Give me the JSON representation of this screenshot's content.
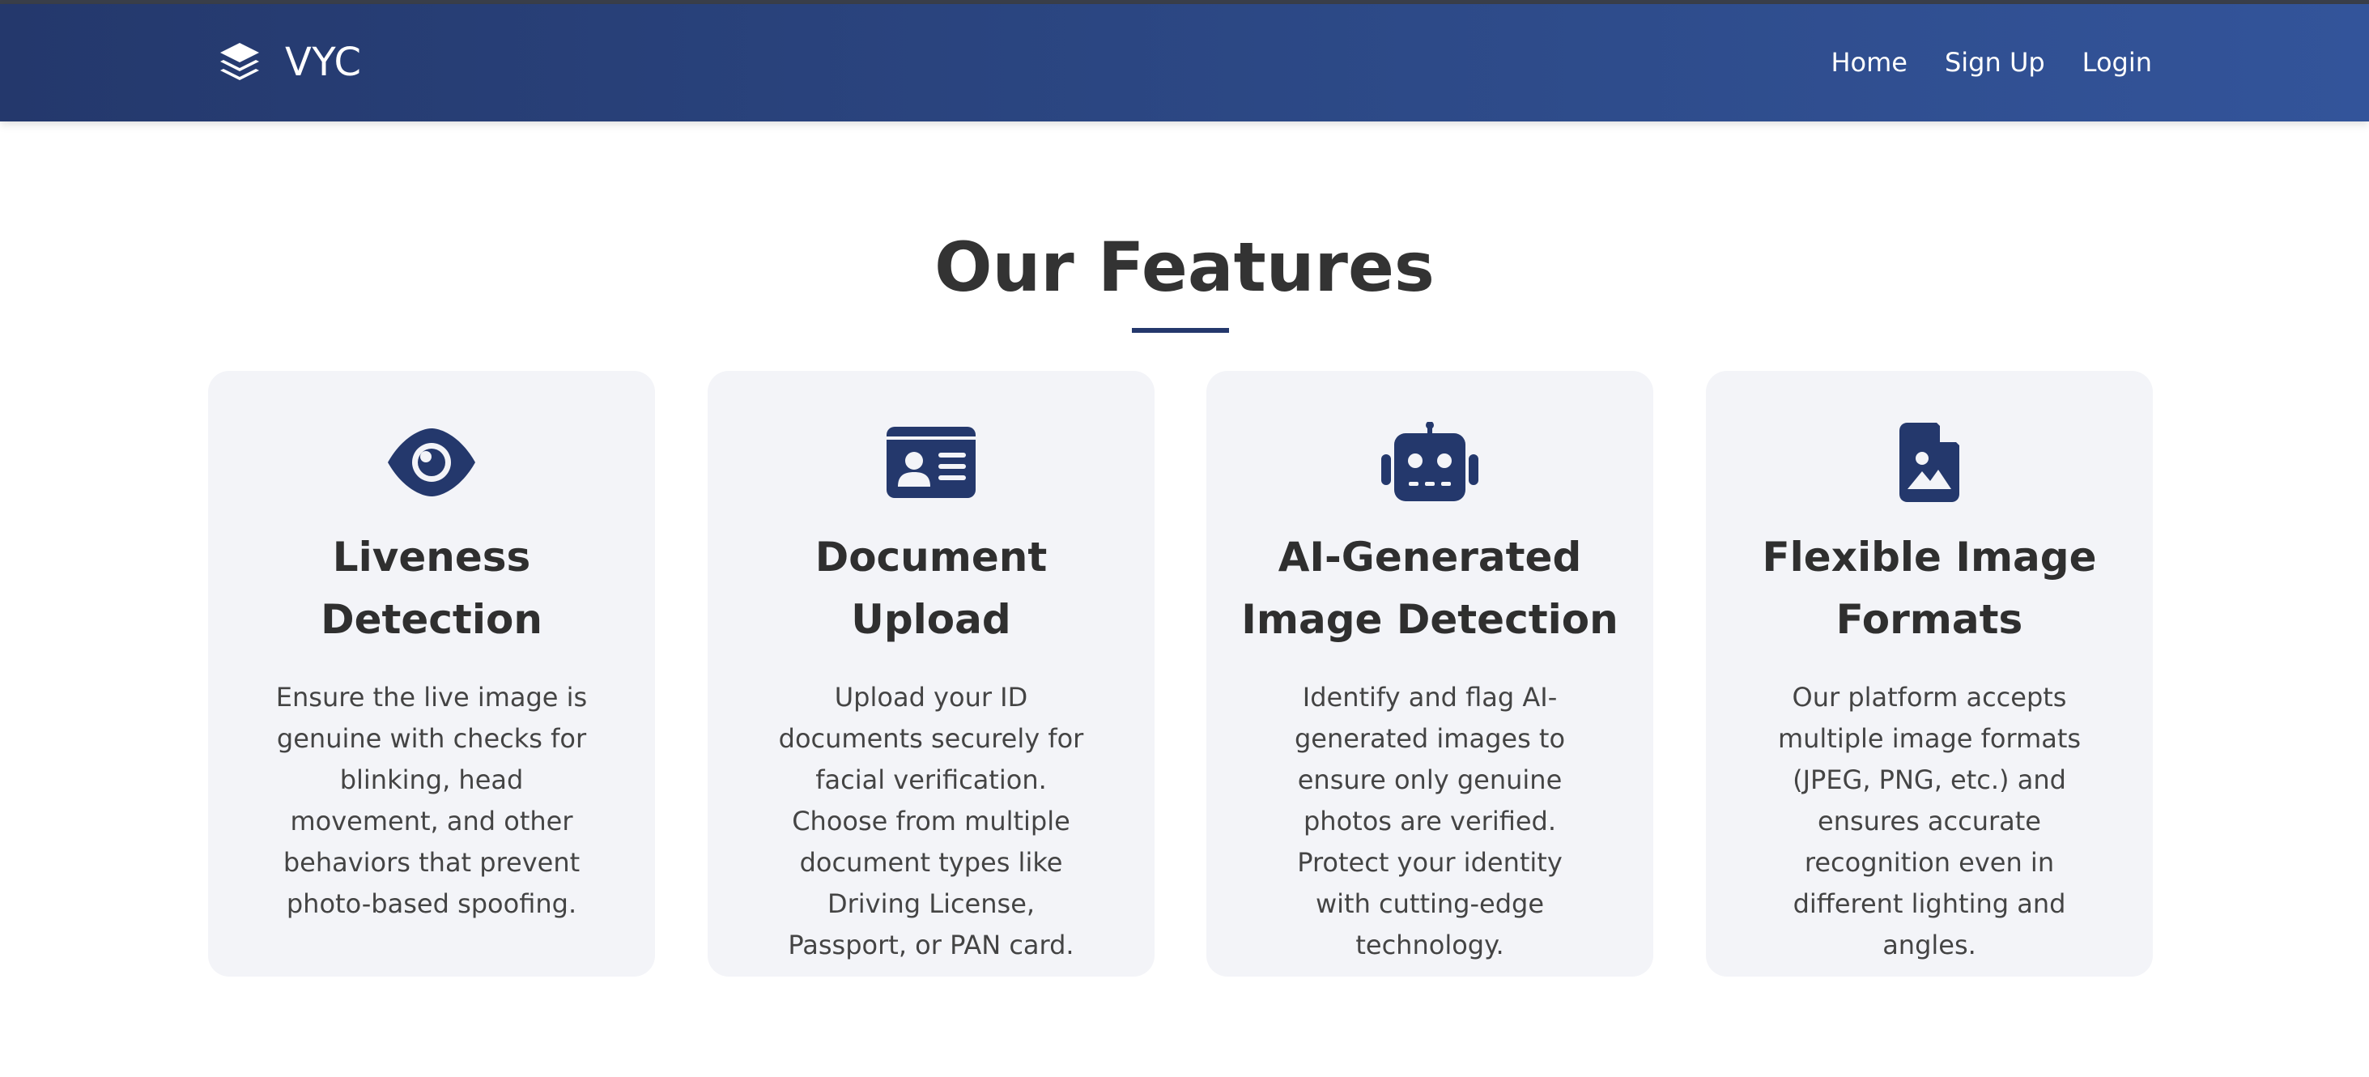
{
  "header": {
    "brand_name": "VYC",
    "brand_icon": "layer-stack-icon",
    "nav": [
      {
        "label": "Home"
      },
      {
        "label": "Sign Up"
      },
      {
        "label": "Login"
      }
    ]
  },
  "features": {
    "title": "Our Features",
    "cards": [
      {
        "icon": "eye-icon",
        "title": "Liveness Detection",
        "text": "Ensure the live image is genuine with checks for blinking, head movement, and other behaviors that prevent photo-based spoofing."
      },
      {
        "icon": "id-card-icon",
        "title": "Document Upload",
        "text": "Upload your ID documents securely for facial verification. Choose from multiple document types like Driving License, Passport, or PAN card."
      },
      {
        "icon": "robot-icon",
        "title": "AI-Generated Image Detection",
        "text": "Identify and flag AI-generated images to ensure only genuine photos are verified. Protect your identity with cutting-edge technology."
      },
      {
        "icon": "file-image-icon",
        "title": "Flexible Image Formats",
        "text": "Our platform accepts multiple image formats (JPEG, PNG, etc.) and ensures accurate recognition even in different lighting and angles."
      }
    ]
  },
  "colors": {
    "primary": "#24386c",
    "card_bg": "#f3f4f8",
    "text": "#333333"
  }
}
